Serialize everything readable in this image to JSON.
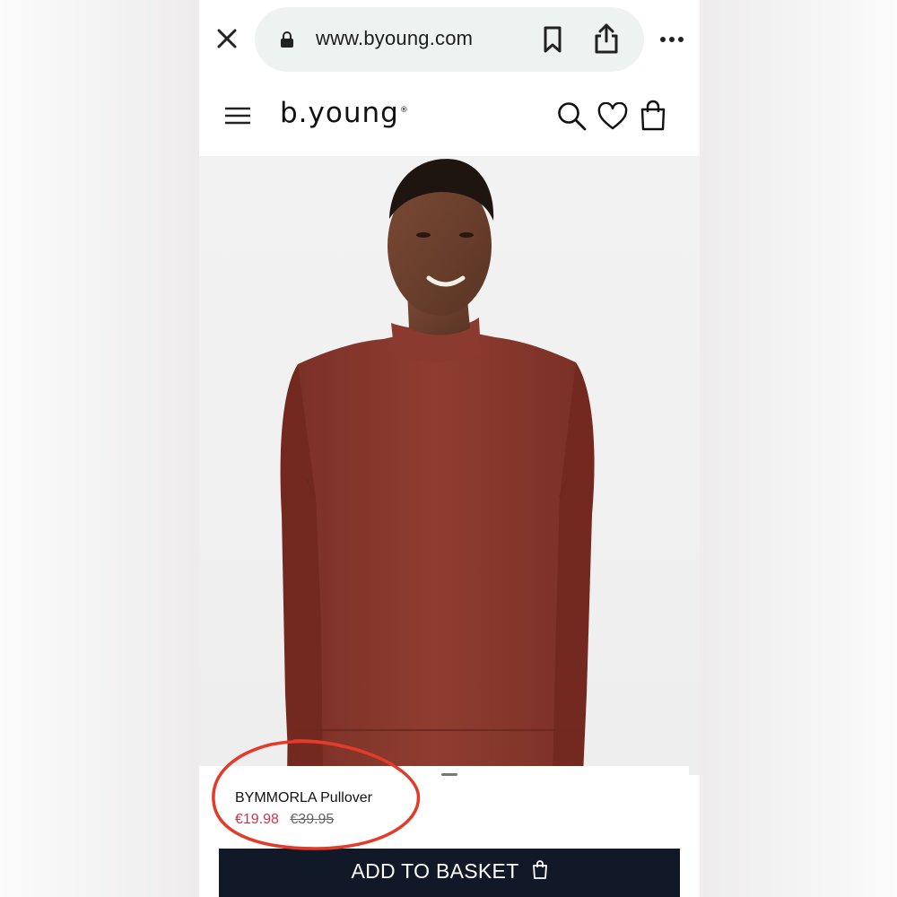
{
  "browser": {
    "url": "www.byoung.com",
    "icons": {
      "close": "close-icon",
      "lock": "lock-icon",
      "bookmark": "bookmark-icon",
      "share": "share-icon",
      "more": "more-icon"
    }
  },
  "site": {
    "logo": "b.young",
    "logo_mark": "®",
    "icons": {
      "menu": "menu-icon",
      "search": "search-icon",
      "wishlist": "heart-icon",
      "basket": "bag-icon"
    }
  },
  "product": {
    "name": "BYMMORLA Pullover",
    "sale_price": "€19.98",
    "original_price": "€39.95",
    "add_button_label": "ADD TO BASKET"
  },
  "colors": {
    "sale_price": "#c8364a",
    "button_bg": "#111828",
    "annotation": "#e23b2a",
    "sweater": "#8a3a2e"
  }
}
